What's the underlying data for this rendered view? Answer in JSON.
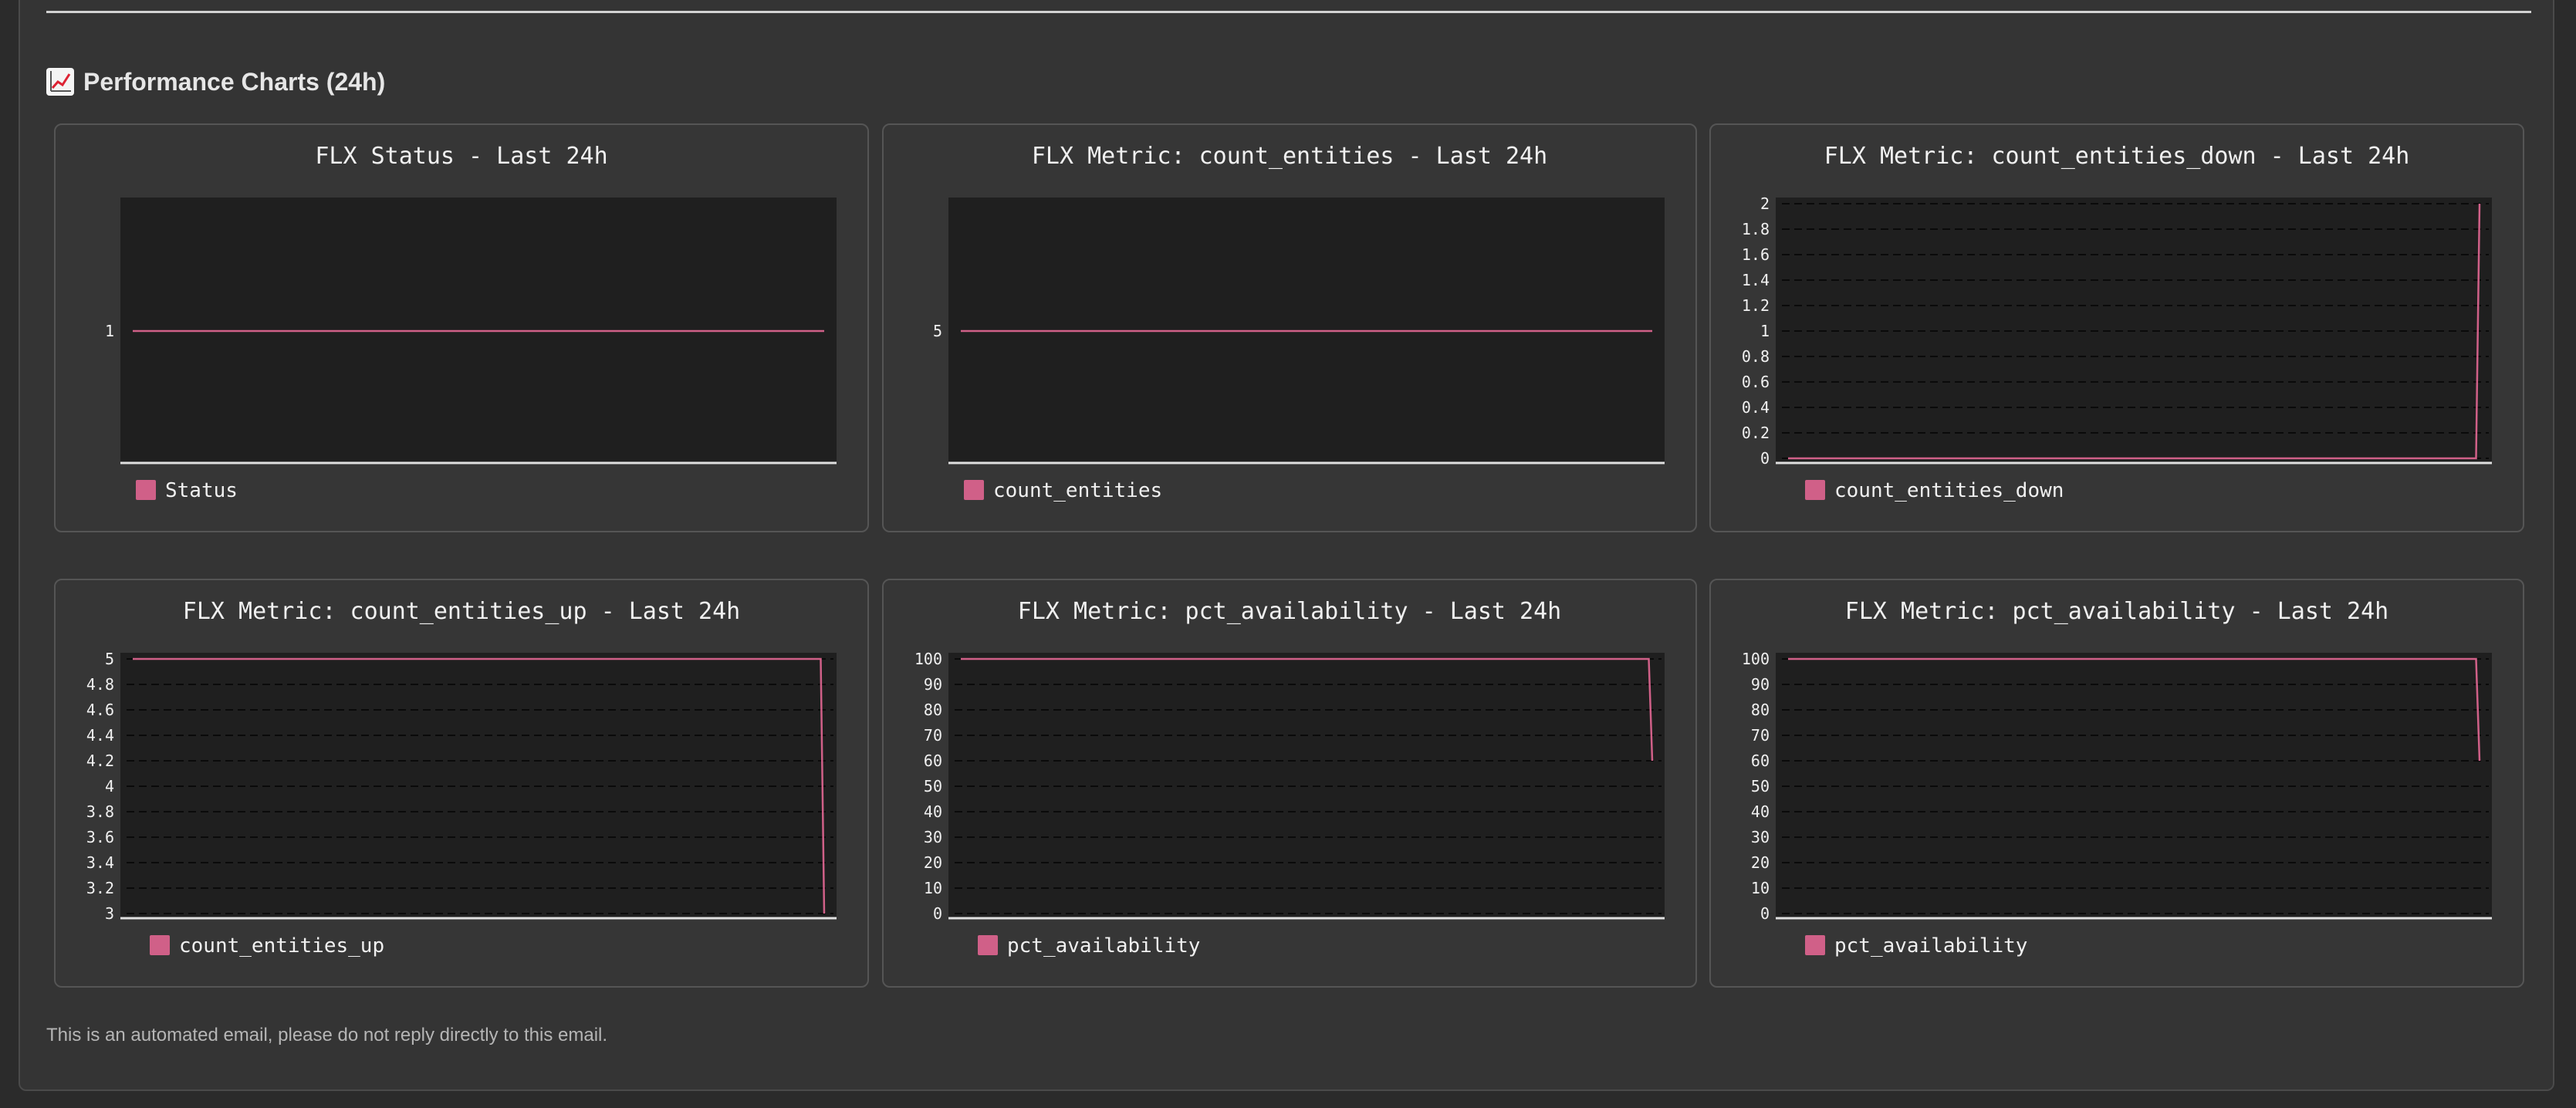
{
  "section": {
    "icon": "chart-increasing-icon",
    "title": "Performance Charts (24h)"
  },
  "footer": {
    "note": "This is an automated email, please do not reply directly to this email."
  },
  "colors": {
    "series": "#d06088",
    "plot_bg": "#1f1f1f",
    "grid": "#0a0a0a",
    "axis": "#e0e0e0",
    "text": "#f0f0f0"
  },
  "chart_data": [
    {
      "type": "line",
      "title": "FLX Status - Last 24h",
      "legend": "top-left-below",
      "grid": false,
      "ylim": [
        0,
        2
      ],
      "yticks": [
        "1"
      ],
      "ytick_values": [
        1
      ],
      "series": [
        {
          "name": "Status",
          "x": [
            0,
            1
          ],
          "values": [
            1,
            1
          ]
        }
      ]
    },
    {
      "type": "line",
      "title": "FLX Metric: count_entities - Last 24h",
      "legend": "top-left-below",
      "grid": false,
      "ylim": [
        4,
        6
      ],
      "yticks": [
        "5"
      ],
      "ytick_values": [
        5
      ],
      "series": [
        {
          "name": "count_entities",
          "x": [
            0,
            1
          ],
          "values": [
            5,
            5
          ]
        }
      ]
    },
    {
      "type": "line",
      "title": "FLX Metric: count_entities_down - Last 24h",
      "legend": "top-left-below",
      "grid": true,
      "ylim": [
        0,
        2
      ],
      "yticks": [
        "0",
        "0.2",
        "0.4",
        "0.6",
        "0.8",
        "1",
        "1.2",
        "1.4",
        "1.6",
        "1.8",
        "2"
      ],
      "ytick_values": [
        0,
        0.2,
        0.4,
        0.6,
        0.8,
        1,
        1.2,
        1.4,
        1.6,
        1.8,
        2
      ],
      "series": [
        {
          "name": "count_entities_down",
          "x": [
            0,
            0.995,
            1
          ],
          "values": [
            0,
            0,
            2
          ]
        }
      ]
    },
    {
      "type": "line",
      "title": "FLX Metric: count_entities_up - Last 24h",
      "legend": "top-left-below",
      "grid": true,
      "ylim": [
        3,
        5
      ],
      "yticks": [
        "3",
        "3.2",
        "3.4",
        "3.6",
        "3.8",
        "4",
        "4.2",
        "4.4",
        "4.6",
        "4.8",
        "5"
      ],
      "ytick_values": [
        3,
        3.2,
        3.4,
        3.6,
        3.8,
        4,
        4.2,
        4.4,
        4.6,
        4.8,
        5
      ],
      "series": [
        {
          "name": "count_entities_up",
          "x": [
            0,
            0.995,
            1
          ],
          "values": [
            5,
            5,
            3
          ]
        }
      ]
    },
    {
      "type": "line",
      "title": "FLX Metric: pct_availability - Last 24h",
      "legend": "top-left-below",
      "grid": true,
      "ylim": [
        0,
        100
      ],
      "yticks": [
        "0",
        "10",
        "20",
        "30",
        "40",
        "50",
        "60",
        "70",
        "80",
        "90",
        "100"
      ],
      "ytick_values": [
        0,
        10,
        20,
        30,
        40,
        50,
        60,
        70,
        80,
        90,
        100
      ],
      "series": [
        {
          "name": "pct_availability",
          "x": [
            0,
            0.995,
            1
          ],
          "values": [
            100,
            100,
            60
          ]
        }
      ]
    },
    {
      "type": "line",
      "title": "FLX Metric: pct_availability - Last 24h",
      "legend": "top-left-below",
      "grid": true,
      "ylim": [
        0,
        100
      ],
      "yticks": [
        "0",
        "10",
        "20",
        "30",
        "40",
        "50",
        "60",
        "70",
        "80",
        "90",
        "100"
      ],
      "ytick_values": [
        0,
        10,
        20,
        30,
        40,
        50,
        60,
        70,
        80,
        90,
        100
      ],
      "series": [
        {
          "name": "pct_availability",
          "x": [
            0,
            0.995,
            1
          ],
          "values": [
            100,
            100,
            60
          ]
        }
      ]
    }
  ]
}
